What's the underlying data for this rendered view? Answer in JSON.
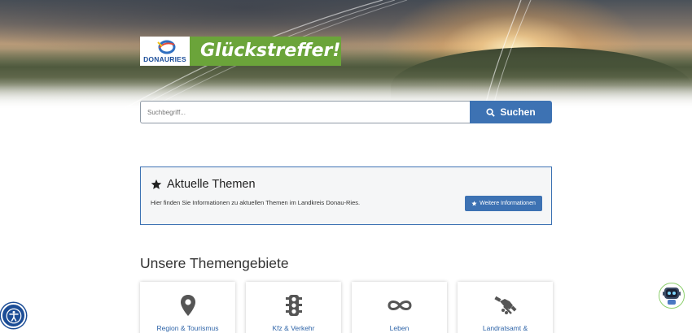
{
  "logo": {
    "wordmark": "DONAURIES",
    "banner": "Glückstreffer!"
  },
  "search": {
    "placeholder": "Suchbegriff...",
    "button_label": "Suchen",
    "button_icon": "search-icon"
  },
  "news": {
    "title": "Aktuelle Themen",
    "title_icon": "star-icon",
    "text": "Hier finden Sie Informationen zu aktuellen Themen im Landkreis Donau-Ries.",
    "button_label": "Weitere Informationen",
    "button_icon": "star-icon"
  },
  "themes": {
    "title": "Unsere Themengebiete",
    "cards": [
      {
        "label": "Region & Tourismus",
        "icon": "map-pin-icon"
      },
      {
        "label": "Kfz & Verkehr",
        "icon": "traffic-light-icon"
      },
      {
        "label": "Leben",
        "icon": "infinity-icon"
      },
      {
        "label": "Landratsamt &",
        "icon": "handshake-icon"
      }
    ]
  },
  "colors": {
    "primary": "#3d72b3",
    "banner_green": "#6ba43a",
    "link": "#2e64a8",
    "a11y_blue": "#1c4d96"
  }
}
